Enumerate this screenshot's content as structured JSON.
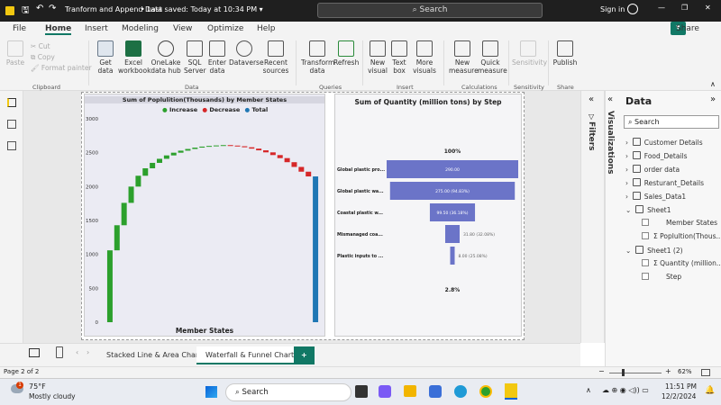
{
  "titlebar": {
    "file_name": "Tranform and Append Data",
    "saved": "Last saved: Today at 10:34 PM",
    "search": "Search",
    "sign_in": "Sign in"
  },
  "menu": {
    "file": "File",
    "home": "Home",
    "insert": "Insert",
    "modeling": "Modeling",
    "view": "View",
    "optimize": "Optimize",
    "help": "Help",
    "share": "Share"
  },
  "ribbon": {
    "paste": "Paste",
    "cut": "Cut",
    "copy": "Copy",
    "format_painter": "Format painter",
    "clipboard": "Clipboard",
    "get_data": "Get data",
    "excel": "Excel workbook",
    "onelake": "OneLake data hub",
    "sql": "SQL Server",
    "enter": "Enter data",
    "dataverse": "Dataverse",
    "recent": "Recent sources",
    "data": "Data",
    "transform": "Transform data",
    "refresh": "Refresh",
    "queries": "Queries",
    "new_visual": "New visual",
    "text_box": "Text box",
    "more_visuals": "More visuals",
    "insert": "Insert",
    "new_measure": "New measure",
    "quick_measure": "Quick measure",
    "calculations": "Calculations",
    "sensitivity": "Sensitivity",
    "sensitivity_grp": "Sensitivity",
    "publish": "Publish",
    "share_grp": "Share"
  },
  "waterfall": {
    "title": "Sum of Poplulition(Thousands) by Member States",
    "legend": [
      "Increase",
      "Decrease",
      "Total"
    ],
    "colors": {
      "increase": "#2ca02c",
      "decrease": "#d62728",
      "total": "#1f77b4"
    },
    "xlabel": "Member States",
    "yticks": [
      "3000",
      "2500",
      "2000",
      "1500",
      "1000",
      "500",
      "0"
    ]
  },
  "funnel": {
    "title": "Sum of Quantity (million tons) by Step",
    "top_pct": "100%",
    "bottom_pct": "2.8%",
    "bar_color": "#6b74c8",
    "steps": [
      {
        "label": "Global plastic pro...",
        "value": "290.00"
      },
      {
        "label": "Global plastic wa...",
        "value": "275.00 (94.83%)"
      },
      {
        "label": "Coastal plastic w...",
        "value": "99.50 (36.18%)"
      },
      {
        "label": "Mismanaged coa...",
        "value": "31.80 (32.08%)"
      },
      {
        "label": "Plastic inputs to ...",
        "value": "8.00 (25.08%)"
      }
    ]
  },
  "chart_data": [
    {
      "type": "bar",
      "title": "Sum of Poplulition(Thousands) by Member States",
      "xlabel": "Member States",
      "ylabel": "",
      "ylim": [
        0,
        3000
      ],
      "series": [
        {
          "name": "Increase"
        },
        {
          "name": "Decrease"
        },
        {
          "name": "Total"
        }
      ],
      "steps": [
        {
          "kind": "increase",
          "start": 0,
          "end": 1060
        },
        {
          "kind": "increase",
          "start": 1060,
          "end": 1430
        },
        {
          "kind": "increase",
          "start": 1430,
          "end": 1760
        },
        {
          "kind": "increase",
          "start": 1760,
          "end": 2000
        },
        {
          "kind": "increase",
          "start": 2000,
          "end": 2160
        },
        {
          "kind": "increase",
          "start": 2160,
          "end": 2270
        },
        {
          "kind": "increase",
          "start": 2270,
          "end": 2350
        },
        {
          "kind": "increase",
          "start": 2350,
          "end": 2410
        },
        {
          "kind": "increase",
          "start": 2410,
          "end": 2460
        },
        {
          "kind": "increase",
          "start": 2460,
          "end": 2500
        },
        {
          "kind": "increase",
          "start": 2500,
          "end": 2530
        },
        {
          "kind": "increase",
          "start": 2530,
          "end": 2555
        },
        {
          "kind": "increase",
          "start": 2555,
          "end": 2575
        },
        {
          "kind": "increase",
          "start": 2575,
          "end": 2590
        },
        {
          "kind": "increase",
          "start": 2590,
          "end": 2600
        },
        {
          "kind": "increase",
          "start": 2600,
          "end": 2607
        },
        {
          "kind": "increase",
          "start": 2607,
          "end": 2612
        },
        {
          "kind": "decrease",
          "start": 2612,
          "end": 2605
        },
        {
          "kind": "decrease",
          "start": 2605,
          "end": 2595
        },
        {
          "kind": "decrease",
          "start": 2595,
          "end": 2580
        },
        {
          "kind": "decrease",
          "start": 2580,
          "end": 2560
        },
        {
          "kind": "decrease",
          "start": 2560,
          "end": 2535
        },
        {
          "kind": "decrease",
          "start": 2535,
          "end": 2505
        },
        {
          "kind": "decrease",
          "start": 2505,
          "end": 2465
        },
        {
          "kind": "decrease",
          "start": 2465,
          "end": 2420
        },
        {
          "kind": "decrease",
          "start": 2420,
          "end": 2360
        },
        {
          "kind": "decrease",
          "start": 2360,
          "end": 2290
        },
        {
          "kind": "decrease",
          "start": 2290,
          "end": 2220
        },
        {
          "kind": "decrease",
          "start": 2220,
          "end": 2150
        },
        {
          "kind": "total",
          "start": 0,
          "end": 2150
        }
      ]
    },
    {
      "type": "funnel",
      "title": "Sum of Quantity (million tons) by Step",
      "categories": [
        "Global plastic pro...",
        "Global plastic wa...",
        "Coastal plastic w...",
        "Mismanaged coa...",
        "Plastic inputs to ..."
      ],
      "values": [
        290,
        275,
        99.5,
        31.8,
        8
      ]
    }
  ],
  "data_pane": {
    "visualizations": "Visualizations",
    "filters": "Filters",
    "title": "Data",
    "search": "Search",
    "tables": [
      "Customer Details",
      "Food_Details",
      "order data",
      "Resturant_Details",
      "Sales_Data1",
      "Sheet1"
    ],
    "sheet1_fields": [
      "Member States",
      "Poplultion(Thous..."
    ],
    "sheet1_2": "Sheet1 (2)",
    "sheet1_2_fields": [
      "Quantity (million...",
      "Step"
    ]
  },
  "tabs": {
    "tab1": "Stacked Line & Area Chart",
    "tab2": "Waterfall & Funnel Chart",
    "add": "+"
  },
  "status": {
    "page": "Page 2 of 2",
    "zoom": "62%"
  },
  "taskbar": {
    "temp": "75°F",
    "weather": "Mostly cloudy",
    "search": "Search",
    "time": "11:51 PM",
    "date": "12/2/2024",
    "badge": "1"
  }
}
